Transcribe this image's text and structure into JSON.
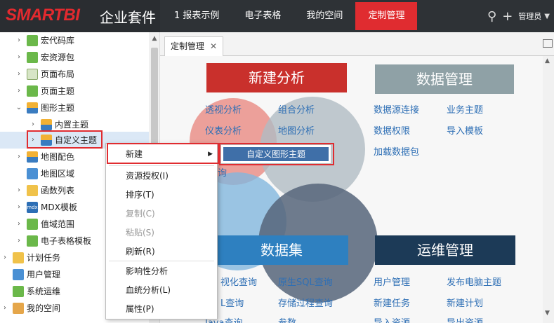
{
  "app": {
    "logo": "SMARTBI",
    "suite": "企业套件"
  },
  "nav": {
    "items": [
      {
        "label": "1 报表示例"
      },
      {
        "label": "电子表格"
      },
      {
        "label": "我的空间"
      },
      {
        "label": "定制管理"
      }
    ],
    "active_index": 3,
    "user": "管理员"
  },
  "sidebar": {
    "items": [
      {
        "label": "宏代码库"
      },
      {
        "label": "宏资源包"
      },
      {
        "label": "页面布局"
      },
      {
        "label": "页面主题"
      },
      {
        "label": "图形主题"
      },
      {
        "label": "内置主题"
      },
      {
        "label": "自定义主题"
      },
      {
        "label": "地图配色"
      },
      {
        "label": "地图区域"
      },
      {
        "label": "函数列表"
      },
      {
        "label": "MDX模板"
      },
      {
        "label": "值域范围"
      },
      {
        "label": "电子表格模板"
      },
      {
        "label": "计划任务"
      },
      {
        "label": "用户管理"
      },
      {
        "label": "系统运维"
      },
      {
        "label": "我的空间"
      }
    ],
    "mdx_icon_text": "mdx"
  },
  "tab": {
    "label": "定制管理"
  },
  "panels": {
    "new_analysis": {
      "title": "新建分析",
      "color": "#c9302c",
      "links": [
        "透视分析",
        "组合分析",
        "仪表分析",
        "地图分析",
        "询"
      ]
    },
    "data_mgmt": {
      "title": "数据管理",
      "color": "#8fa1a6",
      "links": [
        "数据源连接",
        "业务主题",
        "数据权限",
        "导入模板",
        "加载数据包"
      ]
    },
    "dataset": {
      "title": "数据集",
      "color": "#2e80c0",
      "links": [
        "视化查询",
        "原生SQL查询",
        "L查询",
        "存储过程查询",
        "Java查询",
        "参数"
      ]
    },
    "ops": {
      "title": "运维管理",
      "color": "#1c3a57",
      "links": [
        "用户管理",
        "发布电脑主题",
        "新建任务",
        "新建计划",
        "导入资源",
        "导出资源"
      ]
    }
  },
  "context_menu": {
    "items": [
      {
        "label": "新建",
        "disabled": false
      },
      {
        "label": "资源授权(I)",
        "disabled": false
      },
      {
        "label": "排序(T)",
        "disabled": false
      },
      {
        "label": "复制(C)",
        "disabled": true
      },
      {
        "label": "粘贴(S)",
        "disabled": true
      },
      {
        "label": "刷新(R)",
        "disabled": false
      },
      {
        "label": "影响性分析",
        "disabled": false
      },
      {
        "label": "血统分析(L)",
        "disabled": false
      },
      {
        "label": "属性(P)",
        "disabled": false
      }
    ],
    "submenu_item": "自定义图形主题"
  },
  "colors": {
    "accent": "#e02c30",
    "topbar": "#2e3236",
    "link": "#2e6fb5"
  }
}
